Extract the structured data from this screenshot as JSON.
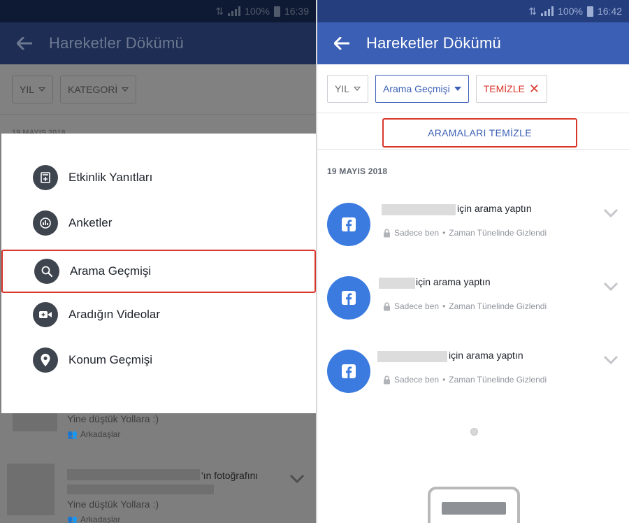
{
  "status_bar": {
    "battery": "100%",
    "time_left": "16:39",
    "time_right": "16:42"
  },
  "app_bar": {
    "title": "Hareketler Dökümü"
  },
  "left": {
    "filters": {
      "year": "YIL",
      "category": "KATEGORİ"
    },
    "date": "19 MAYIS 2018",
    "menu": [
      {
        "label": "Etkinlik Yanıtları",
        "icon": "calendar-plus-icon"
      },
      {
        "label": "Anketler",
        "icon": "poll-chart-icon"
      },
      {
        "label": "Arama Geçmişi",
        "icon": "search-icon"
      },
      {
        "label": "Aradığın Videolar",
        "icon": "video-camera-icon"
      },
      {
        "label": "Konum Geçmişi",
        "icon": "location-pin-icon"
      }
    ],
    "feed": [
      {
        "text": "Yine düştük Yollara :)",
        "privacy": "Arkadaşlar"
      },
      {
        "text": "'ın fotoğrafını"
      },
      {
        "text": "Yine düştük Yollara :)",
        "privacy": "Arkadaşlar"
      }
    ]
  },
  "right": {
    "filters": {
      "year": "YIL",
      "active": "Arama Geçmişi",
      "clear": "TEMİZLE"
    },
    "clear_searches": "ARAMALARI TEMİZLE",
    "date": "19 MAYIS 2018",
    "entries": [
      {
        "text": "için arama yaptın",
        "privacy": "Sadece ben",
        "visibility": "Zaman Tünelinde Gizlendi"
      },
      {
        "text": "için arama yaptın",
        "privacy": "Sadece ben",
        "visibility": "Zaman Tünelinde Gizlendi"
      },
      {
        "text": "için arama yaptın",
        "privacy": "Sadece ben",
        "visibility": "Zaman Tünelinde Gizlendi"
      }
    ]
  },
  "colors": {
    "facebook_blue": "#3b5fb5",
    "highlight_red": "#d9362c",
    "entry_icon": "#3b7be0"
  }
}
